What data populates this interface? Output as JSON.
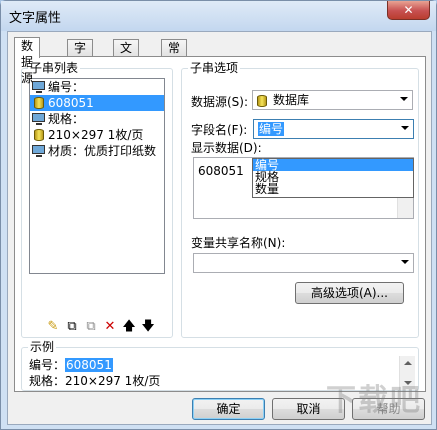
{
  "window": {
    "title": "文字属性",
    "close_glyph": "✕"
  },
  "tabs": [
    {
      "label": "数据源",
      "active": true
    },
    {
      "label": "字体",
      "active": false
    },
    {
      "label": "文本",
      "active": false
    },
    {
      "label": "常规",
      "active": false
    }
  ],
  "sub_list": {
    "title": "子串列表",
    "items": [
      {
        "icon": "monitor-icon",
        "text": "编号："
      },
      {
        "icon": "database-icon",
        "text": "608051",
        "selected": true
      },
      {
        "icon": "monitor-icon",
        "text": "规格："
      },
      {
        "icon": "database-icon",
        "text": "210×297 1枚/页"
      },
      {
        "icon": "monitor-icon",
        "text": "材质：优质打印纸数"
      }
    ]
  },
  "tools": {
    "new": "✎",
    "copy": "⧉",
    "paste": "⧉",
    "delete": "✕",
    "up": "🡅",
    "down": "🡇"
  },
  "options": {
    "title": "子串选项",
    "datasource_label": "数据源(S):",
    "datasource_value": "数据库",
    "field_label": "字段名(F):",
    "field_value": "编号",
    "field_options": [
      "编号",
      "规格",
      "数量"
    ],
    "display_label": "显示数据(D):",
    "display_value": "608051",
    "shared_var_label": "变量共享名称(N):",
    "shared_var_value": "",
    "advanced_button": "高级选项(A)..."
  },
  "example": {
    "title": "示例",
    "line1_prefix": "编号：",
    "line1_value": "608051",
    "line2": "规格：210×297 1枚/页"
  },
  "buttons": {
    "ok": "确定",
    "cancel": "取消",
    "help": "帮助"
  },
  "watermark": "下载吧"
}
